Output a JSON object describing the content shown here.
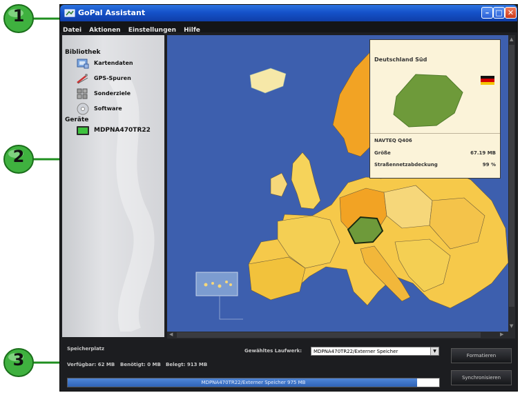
{
  "window": {
    "title": "GoPal Assistant"
  },
  "menu": [
    "Datei",
    "Aktionen",
    "Einstellungen",
    "Hilfe"
  ],
  "sidebar": {
    "library_heading": "Bibliothek",
    "library_items": [
      {
        "label": "Kartendaten",
        "icon": "map-data-icon"
      },
      {
        "label": "GPS-Spuren",
        "icon": "gps-tracks-icon"
      },
      {
        "label": "Sonderziele",
        "icon": "poi-icon"
      },
      {
        "label": "Software",
        "icon": "software-cd-icon"
      }
    ],
    "devices_heading": "Geräte",
    "device": {
      "label": "MDPNA470TR22",
      "icon": "device-icon"
    }
  },
  "info_card": {
    "title": "Deutschland Süd",
    "provider": "NAVTEQ Q406",
    "size_label": "Größe",
    "size_value": "67.19 MB",
    "coverage_label": "Straßennetzabdeckung",
    "coverage_value": "99 %"
  },
  "bottom": {
    "storage_label": "Speicherplatz",
    "free_text": "Verfügbar: 62 MB",
    "required_text": "Benötigt: 0 MB",
    "used_text": "Belegt: 913 MB",
    "drive_label": "Gewähltes Laufwerk:",
    "drive_value": "MDPNA470TR22/Externer Speicher",
    "bar_text": "MDPNA470TR22/Externer Speicher 975 MB",
    "bar_fill_fraction": 0.94,
    "format_button": "Formatieren",
    "sync_button": "Synchronisieren"
  },
  "callouts": [
    "1",
    "2",
    "3"
  ],
  "colors": {
    "ocean": "#3d5fae",
    "map_light": "#f6d77a",
    "map_orange": "#f2a324",
    "selected_region": "#6e9a3a"
  }
}
